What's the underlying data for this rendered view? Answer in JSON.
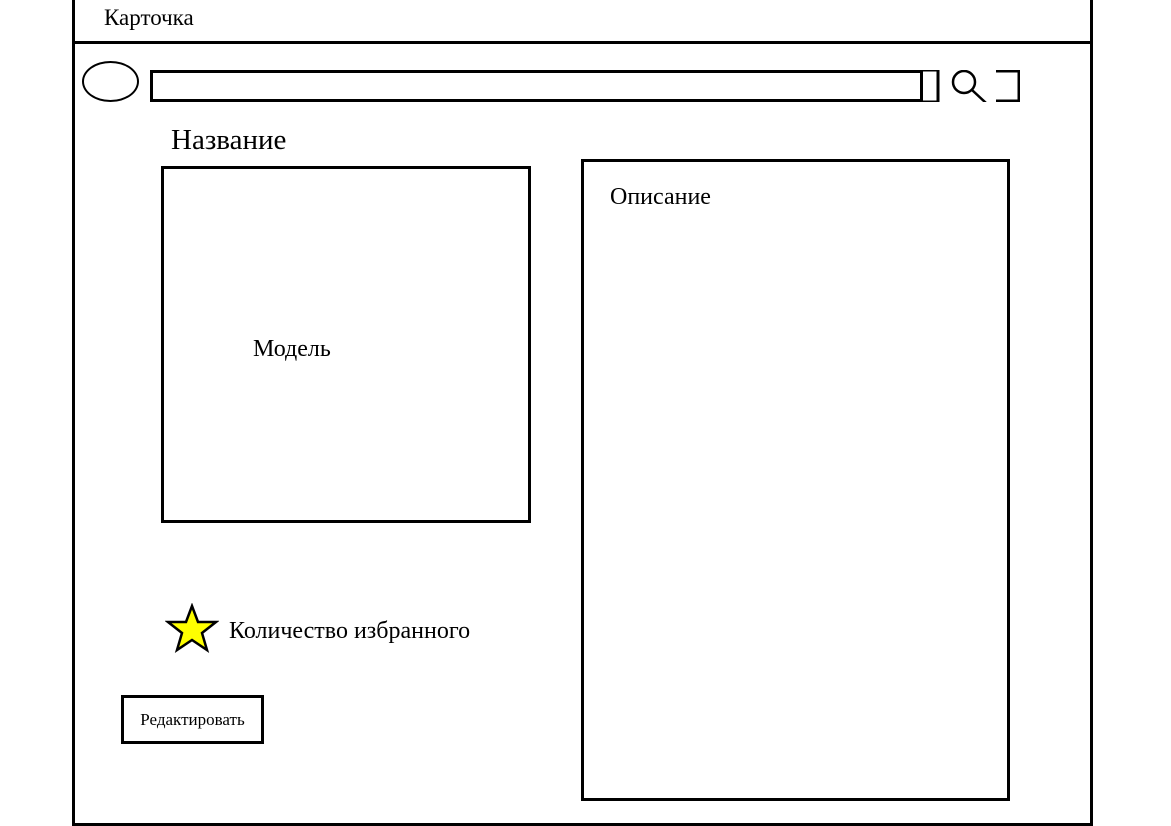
{
  "window": {
    "title": "Карточка"
  },
  "search": {
    "value": "",
    "placeholder": "",
    "icon": "magnifier-icon"
  },
  "avatar": {
    "icon": "avatar-oval"
  },
  "product": {
    "title": "Название",
    "model_label": "Модель",
    "description_label": "Описание",
    "favorites_label": "Количество избранного",
    "favorite_icon": "star-icon"
  },
  "actions": {
    "edit_label": "Редактировать"
  },
  "colors": {
    "star_fill": "#ffff00",
    "stroke": "#000000",
    "background": "#ffffff"
  }
}
